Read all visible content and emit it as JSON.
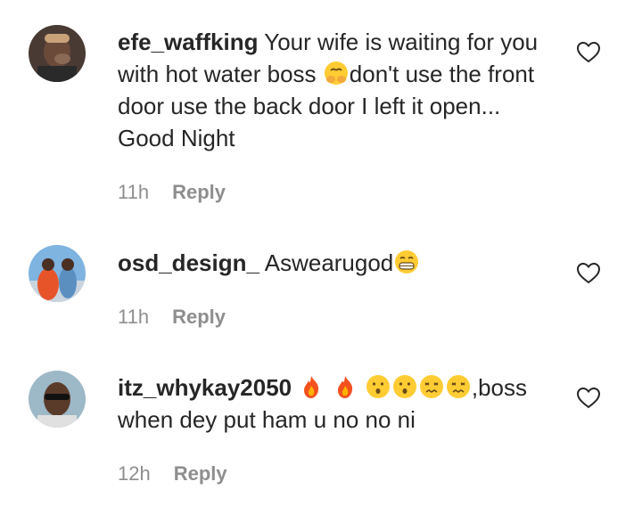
{
  "comments": [
    {
      "username": "efe_waffking",
      "text_parts": [
        "Your wife is waiting for you with hot water boss ",
        "don't use the front door use the back door I left it open... Good Night"
      ],
      "emojis": [
        "hands-over-face-emoji"
      ],
      "time": "11h",
      "reply_label": "Reply"
    },
    {
      "username": "osd_design_",
      "text_parts": [
        "Aswearugod"
      ],
      "emojis": [
        "grimacing-face-emoji"
      ],
      "time": "11h",
      "reply_label": "Reply"
    },
    {
      "username": "itz_whykay2050",
      "text_parts": [
        ",boss when dey put ham u no no ni"
      ],
      "emojis": [
        "fire-emoji",
        "fire-emoji",
        "hushed-face-emoji",
        "hushed-face-emoji",
        "confounded-face-emoji",
        "confounded-face-emoji"
      ],
      "time": "12h",
      "reply_label": "Reply"
    }
  ],
  "colors": {
    "text": "#262626",
    "muted": "#8e8e8e",
    "emoji_yellow": "#ffcc33",
    "fire": "#f4511e"
  }
}
